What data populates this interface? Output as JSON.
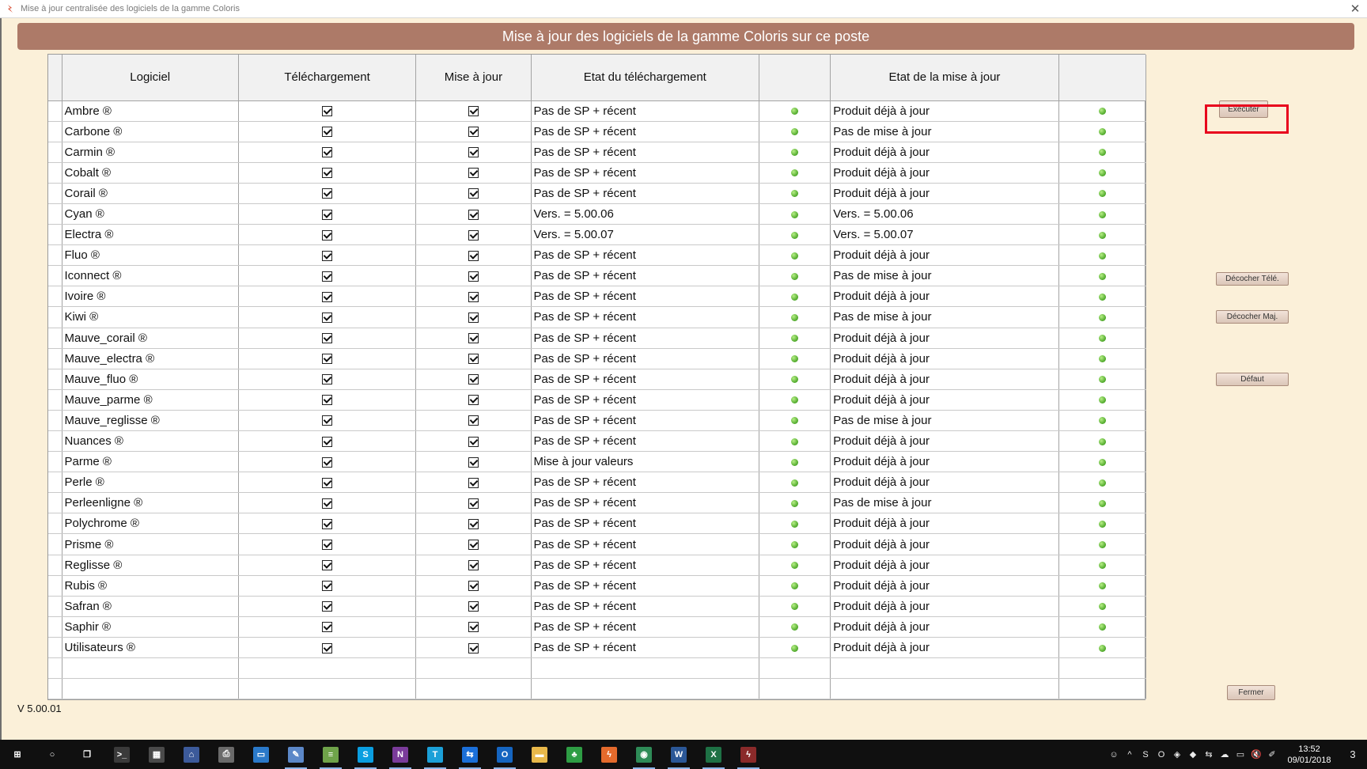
{
  "window": {
    "title": "Mise à jour centralisée des logiciels de la gamme Coloris",
    "close_label": "✕"
  },
  "banner": {
    "title": "Mise à jour des logiciels de la gamme Coloris sur ce poste"
  },
  "table": {
    "headers": [
      "Logiciel",
      "Téléchargement",
      "Mise à jour",
      "Etat du téléchargement",
      "",
      "Etat de la mise à jour",
      ""
    ],
    "rows": [
      {
        "name": "Ambre ®",
        "dl": "Pas de SP + récent",
        "maj": "Produit déjà à jour"
      },
      {
        "name": "Carbone ®",
        "dl": "Pas de SP + récent",
        "maj": "Pas de mise à jour"
      },
      {
        "name": "Carmin ®",
        "dl": "Pas de SP + récent",
        "maj": "Produit déjà à jour"
      },
      {
        "name": "Cobalt ®",
        "dl": "Pas de SP + récent",
        "maj": "Produit déjà à jour"
      },
      {
        "name": "Corail ®",
        "dl": "Pas de SP + récent",
        "maj": "Produit déjà à jour"
      },
      {
        "name": "Cyan ®",
        "dl": "Vers. = 5.00.06",
        "maj": "Vers. = 5.00.06"
      },
      {
        "name": "Electra ®",
        "dl": "Vers. = 5.00.07",
        "maj": "Vers. = 5.00.07"
      },
      {
        "name": "Fluo ®",
        "dl": "Pas de SP + récent",
        "maj": "Produit déjà à jour"
      },
      {
        "name": "Iconnect ®",
        "dl": "Pas de SP + récent",
        "maj": "Pas de mise à jour"
      },
      {
        "name": "Ivoire ®",
        "dl": "Pas de SP + récent",
        "maj": "Produit déjà à jour"
      },
      {
        "name": "Kiwi ®",
        "dl": "Pas de SP + récent",
        "maj": "Pas de mise à jour"
      },
      {
        "name": "Mauve_corail ®",
        "dl": "Pas de SP + récent",
        "maj": "Produit déjà à jour"
      },
      {
        "name": "Mauve_electra ®",
        "dl": "Pas de SP + récent",
        "maj": "Produit déjà à jour"
      },
      {
        "name": "Mauve_fluo ®",
        "dl": "Pas de SP + récent",
        "maj": "Produit déjà à jour"
      },
      {
        "name": "Mauve_parme ®",
        "dl": "Pas de SP + récent",
        "maj": "Produit déjà à jour"
      },
      {
        "name": "Mauve_reglisse ®",
        "dl": "Pas de SP + récent",
        "maj": "Pas de mise à jour"
      },
      {
        "name": "Nuances ®",
        "dl": "Pas de SP + récent",
        "maj": "Produit déjà à jour"
      },
      {
        "name": "Parme ®",
        "dl": "Mise à jour valeurs",
        "maj": "Produit déjà à jour"
      },
      {
        "name": "Perle ®",
        "dl": "Pas de SP + récent",
        "maj": "Produit déjà à jour"
      },
      {
        "name": "Perleenligne ®",
        "dl": "Pas de SP + récent",
        "maj": "Pas de mise à jour"
      },
      {
        "name": "Polychrome ®",
        "dl": "Pas de SP + récent",
        "maj": "Produit déjà à jour"
      },
      {
        "name": "Prisme ®",
        "dl": "Pas de SP + récent",
        "maj": "Produit déjà à jour"
      },
      {
        "name": "Reglisse ®",
        "dl": "Pas de SP + récent",
        "maj": "Produit déjà à jour"
      },
      {
        "name": "Rubis ®",
        "dl": "Pas de SP + récent",
        "maj": "Produit déjà à jour"
      },
      {
        "name": "Safran ®",
        "dl": "Pas de SP + récent",
        "maj": "Produit déjà à jour"
      },
      {
        "name": "Saphir ®",
        "dl": "Pas de SP + récent",
        "maj": "Produit déjà à jour"
      },
      {
        "name": "Utilisateurs ®",
        "dl": "Pas de SP + récent",
        "maj": "Produit déjà à jour"
      }
    ],
    "empty_rows": 2
  },
  "buttons": {
    "executer": "Exécuter",
    "decocher_tele": "Décocher Télé.",
    "decocher_maj": "Décocher Maj.",
    "defaut": "Défaut",
    "fermer": "Fermer"
  },
  "version": "V 5.00.01",
  "taskbar": {
    "apps": [
      {
        "icon": "windows-start-icon",
        "glyph": "⊞",
        "color": "#101010",
        "open": false
      },
      {
        "icon": "search-cortana-icon",
        "glyph": "○",
        "color": "#101010",
        "open": false
      },
      {
        "icon": "task-view-icon",
        "glyph": "❐",
        "color": "#101010",
        "open": false
      },
      {
        "icon": "command-prompt-icon",
        "glyph": ">_",
        "color": "#3a3a3a",
        "open": false
      },
      {
        "icon": "calculator-icon",
        "glyph": "▦",
        "color": "#4a4a4a",
        "open": false
      },
      {
        "icon": "network-app-icon",
        "glyph": "⌂",
        "color": "#3c5a9a",
        "open": false
      },
      {
        "icon": "printer-icon",
        "glyph": "⎙",
        "color": "#6a6a6a",
        "open": false
      },
      {
        "icon": "remote-desktop-icon",
        "glyph": "▭",
        "color": "#2a79c9",
        "open": false
      },
      {
        "icon": "paint-icon",
        "glyph": "✎",
        "color": "#5c88c8",
        "open": true
      },
      {
        "icon": "notepad-icon",
        "glyph": "≡",
        "color": "#6fa34a",
        "open": true
      },
      {
        "icon": "skype-icon",
        "glyph": "S",
        "color": "#0a9ee0",
        "open": true
      },
      {
        "icon": "onenote-icon",
        "glyph": "N",
        "color": "#7a3b9a",
        "open": true
      },
      {
        "icon": "teams-icon",
        "glyph": "T",
        "color": "#1ba0d8",
        "open": true
      },
      {
        "icon": "teamviewer-icon",
        "glyph": "⇆",
        "color": "#1b6fd8",
        "open": true
      },
      {
        "icon": "outlook-icon",
        "glyph": "O",
        "color": "#1565c0",
        "open": true
      },
      {
        "icon": "file-explorer-icon",
        "glyph": "▬",
        "color": "#e8b84a",
        "open": false
      },
      {
        "icon": "clover-app-icon",
        "glyph": "♣",
        "color": "#2e9d44",
        "open": false
      },
      {
        "icon": "coloris-app-icon",
        "glyph": "ϟ",
        "color": "#e46a2c",
        "open": false
      },
      {
        "icon": "chrome-icon",
        "glyph": "◉",
        "color": "#2e8b57",
        "open": true
      },
      {
        "icon": "word-icon",
        "glyph": "W",
        "color": "#2b5797",
        "open": true
      },
      {
        "icon": "excel-icon",
        "glyph": "X",
        "color": "#1e7145",
        "open": true
      },
      {
        "icon": "coloris-update-icon",
        "glyph": "ϟ",
        "color": "#8a2a2a",
        "open": true
      }
    ],
    "tray": [
      {
        "icon": "people-icon",
        "glyph": "☺"
      },
      {
        "icon": "chevron-up-icon",
        "glyph": "^"
      },
      {
        "icon": "skype-tray-icon",
        "glyph": "S"
      },
      {
        "icon": "outlook-tray-icon",
        "glyph": "O"
      },
      {
        "icon": "security-tray-icon",
        "glyph": "◈"
      },
      {
        "icon": "app-tray-icon",
        "glyph": "◆"
      },
      {
        "icon": "teamviewer-tray-icon",
        "glyph": "⇆"
      },
      {
        "icon": "onedrive-tray-icon",
        "glyph": "☁"
      },
      {
        "icon": "network-tray-icon",
        "glyph": "▭"
      },
      {
        "icon": "volume-muted-icon",
        "glyph": "🔇"
      },
      {
        "icon": "pen-tray-icon",
        "glyph": "✐"
      }
    ],
    "time": "13:52",
    "date": "09/01/2018",
    "notifications": "3"
  }
}
